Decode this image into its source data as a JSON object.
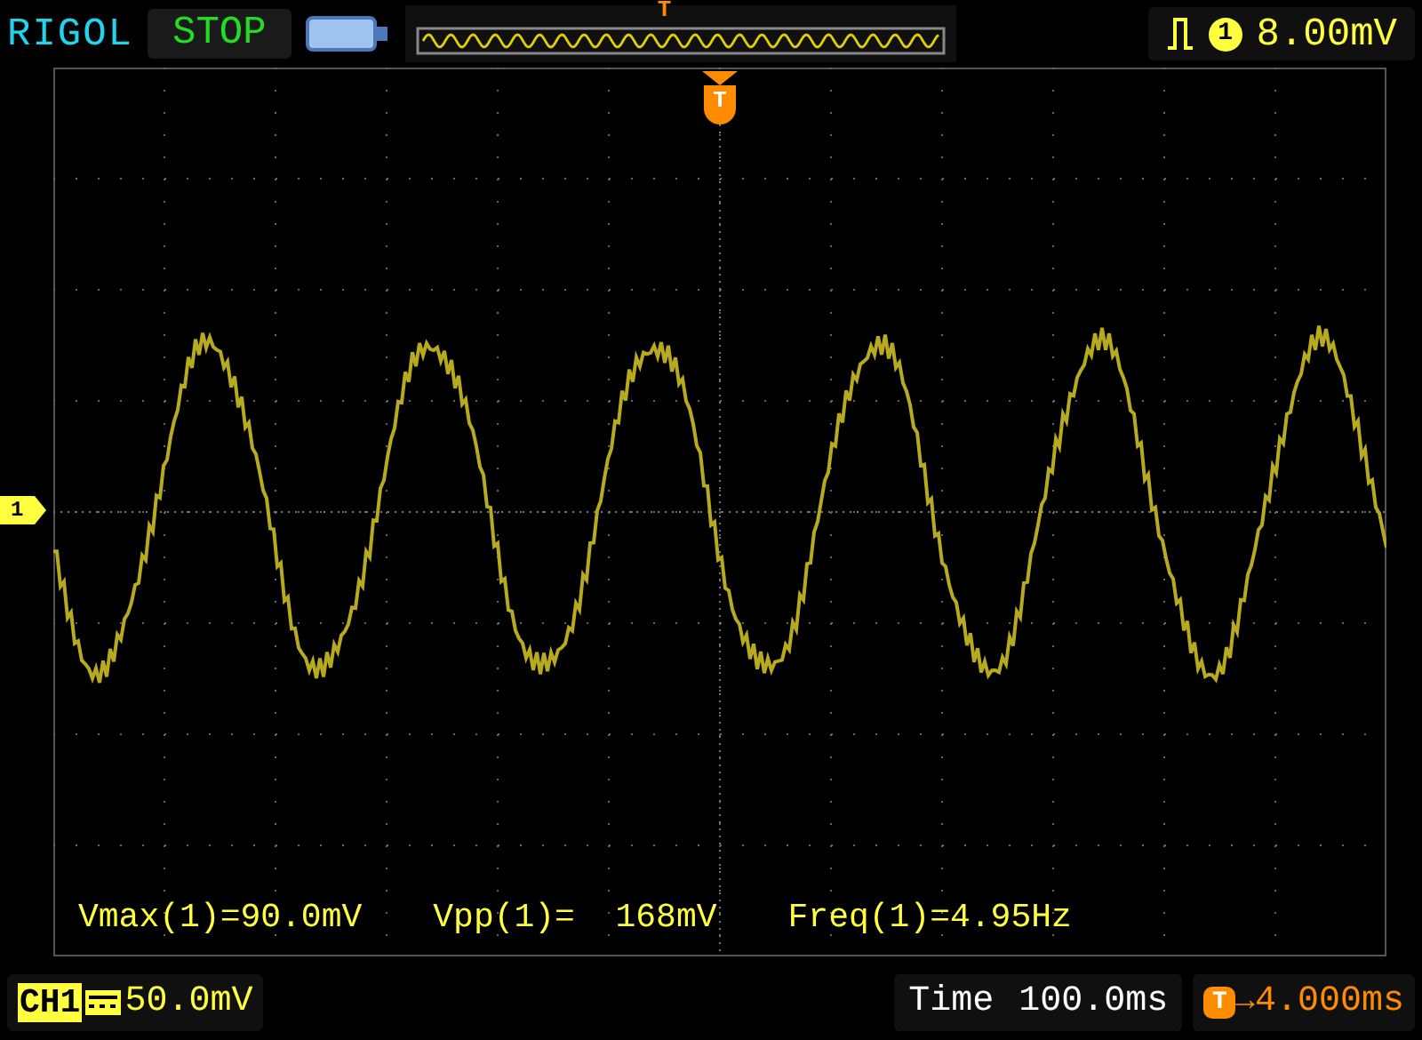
{
  "top_bar": {
    "brand": "RIGOL",
    "run_state": "STOP",
    "memory_trigger_marker": "T",
    "trigger": {
      "channel": "1",
      "level": "8.00mV"
    }
  },
  "screen": {
    "trigger_marker": "T",
    "channel_marker": "1",
    "measurements": [
      {
        "label": "Vmax(1)=90.0mV"
      },
      {
        "label": "Vpp(1)=  168mV"
      },
      {
        "label": "Freq(1)=4.95Hz"
      }
    ]
  },
  "bottom_bar": {
    "channel": "CH1",
    "scale": "50.0mV",
    "time_label": "Time",
    "time_value": "100.0ms",
    "offset": {
      "badge": "T",
      "arrow": "→",
      "value": "4.000ms"
    }
  }
}
